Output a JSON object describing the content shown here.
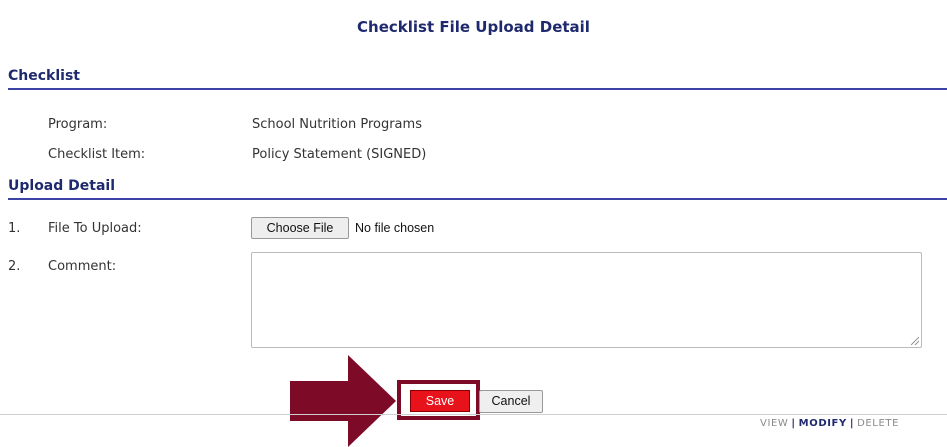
{
  "page": {
    "title": "Checklist File Upload Detail"
  },
  "checklist": {
    "heading": "Checklist",
    "program_label": "Program:",
    "program_value": "School Nutrition Programs",
    "item_label": "Checklist Item:",
    "item_value": "Policy Statement (SIGNED)"
  },
  "upload": {
    "heading": "Upload Detail",
    "row1_num": "1.",
    "file_label": "File To Upload:",
    "choose_file_label": "Choose File",
    "no_file_text": "No file chosen",
    "row2_num": "2.",
    "comment_label": "Comment:",
    "comment_value": ""
  },
  "actions": {
    "save_label": "Save",
    "cancel_label": "Cancel"
  },
  "footer": {
    "view": "VIEW",
    "modify": "MODIFY",
    "delete": "DELETE",
    "separator": "|"
  },
  "annotation": {
    "arrow_icon": "right-arrow-icon",
    "color": "#7d0a27"
  },
  "colors": {
    "heading": "#1f2a6e",
    "save_bg": "#e8121b",
    "highlight": "#7d0a27"
  }
}
